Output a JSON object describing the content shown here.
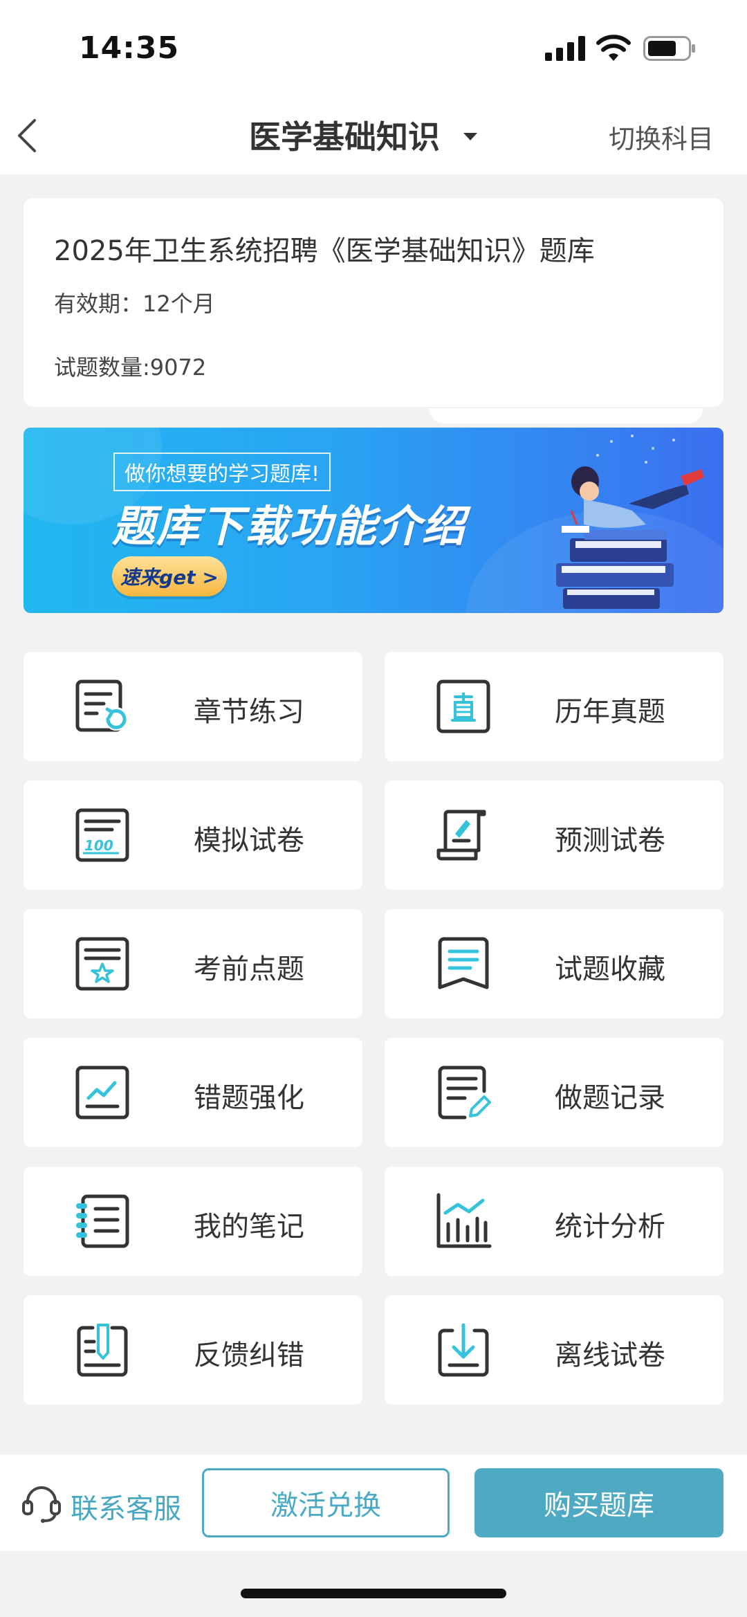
{
  "status_bar": {
    "time": "14:35"
  },
  "nav": {
    "title": "医学基础知识",
    "switch_label": "切换科目"
  },
  "bank": {
    "title": "2025年卫生系统招聘《医学基础知识》题库",
    "validity": "有效期：12个月",
    "question_count": "试题数量:9072"
  },
  "banner": {
    "subtitle": "做你想要的学习题库!",
    "title": "题库下载功能介绍",
    "button": "速来get >"
  },
  "grid": [
    {
      "label": "章节练习",
      "icon": "chapter-practice-icon"
    },
    {
      "label": "历年真题",
      "icon": "past-exams-icon"
    },
    {
      "label": "模拟试卷",
      "icon": "mock-paper-icon"
    },
    {
      "label": "预测试卷",
      "icon": "forecast-paper-icon"
    },
    {
      "label": "考前点题",
      "icon": "pre-exam-tips-icon"
    },
    {
      "label": "试题收藏",
      "icon": "bookmark-icon"
    },
    {
      "label": "错题强化",
      "icon": "wrong-questions-icon"
    },
    {
      "label": "做题记录",
      "icon": "practice-record-icon"
    },
    {
      "label": "我的笔记",
      "icon": "notes-icon"
    },
    {
      "label": "统计分析",
      "icon": "statistics-icon"
    },
    {
      "label": "反馈纠错",
      "icon": "feedback-icon"
    },
    {
      "label": "离线试卷",
      "icon": "offline-download-icon"
    }
  ],
  "bottom": {
    "customer_service": "联系客服",
    "activate": "激活兑换",
    "buy": "购买题库"
  },
  "colors": {
    "accent": "#4eaac3",
    "icon_teal": "#35c3dc",
    "icon_dark": "#333333"
  }
}
